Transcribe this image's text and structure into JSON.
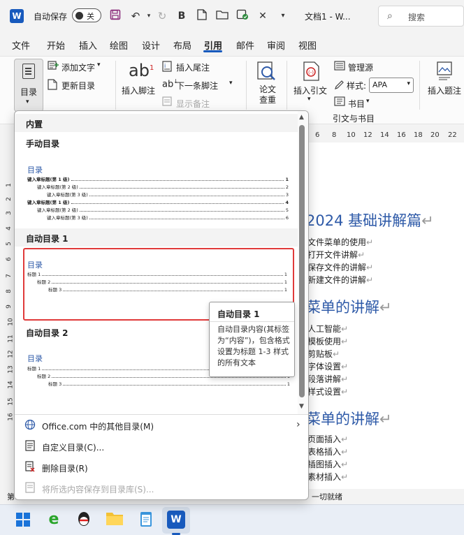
{
  "titlebar": {
    "autosave_label": "自动保存",
    "autosave_state": "关",
    "doc_title": "文档1 - W...",
    "search_placeholder": "搜索"
  },
  "tabs": [
    "文件",
    "开始",
    "插入",
    "绘图",
    "设计",
    "布局",
    "引用",
    "邮件",
    "审阅",
    "视图"
  ],
  "active_tab": "引用",
  "ribbon": {
    "toc_button": "目录",
    "add_text": "添加文字",
    "update_toc": "更新目录",
    "insert_footnote": "插入脚注",
    "insert_endnote": "插入尾注",
    "next_footnote": "下一条脚注",
    "show_notes": "显示备注",
    "research": "论文查重",
    "insert_citation": "插入引文",
    "manage_sources": "管理源",
    "style_label": "样式:",
    "style_value": "APA",
    "bibliography": "书目",
    "group_label": "引文与书目",
    "insert_caption": "插入题注"
  },
  "ruler": [
    "6",
    "8",
    "10",
    "12",
    "14",
    "16",
    "18",
    "20",
    "22"
  ],
  "ruler_left": [
    "1",
    "2",
    "3",
    "4",
    "5",
    "6",
    "7",
    "8",
    "9",
    "10",
    "11",
    "12",
    "13",
    "14",
    "15",
    "16"
  ],
  "toc_panel": {
    "builtin_header": "内置",
    "manual_title": "手动目录",
    "manual_preview": {
      "heading": "目录",
      "lines": [
        {
          "text": "键入章标题(第 1 级)",
          "page": "1",
          "level": 1
        },
        {
          "text": "键入章标题(第 2 级)",
          "page": "2",
          "level": 2
        },
        {
          "text": "键入章标题(第 3 级)",
          "page": "3",
          "level": 3
        },
        {
          "text": "键入章标题(第 1 级)",
          "page": "4",
          "level": 1
        },
        {
          "text": "键入章标题(第 2 级)",
          "page": "5",
          "level": 2
        },
        {
          "text": "键入章标题(第 3 级)",
          "page": "6",
          "level": 3
        }
      ]
    },
    "auto1_title": "自动目录 1",
    "auto1_preview": {
      "heading": "目录",
      "lines": [
        {
          "text": "标题 1",
          "page": "1",
          "level": 1
        },
        {
          "text": "标题 2",
          "page": "1",
          "level": 2
        },
        {
          "text": "标题 3",
          "page": "1",
          "level": 3
        }
      ]
    },
    "auto2_title": "自动目录 2",
    "auto2_preview": {
      "heading": "目录",
      "lines": [
        {
          "text": "标题 1",
          "page": "1",
          "level": 1
        },
        {
          "text": "标题 2",
          "page": "1",
          "level": 2
        },
        {
          "text": "标题 3",
          "page": "1",
          "level": 3
        }
      ]
    },
    "menu": {
      "more_toc": "Office.com 中的其他目录(M)",
      "custom_toc": "自定义目录(C)...",
      "remove_toc": "删除目录(R)",
      "save_selection": "将所选内容保存到目录库(S)..."
    }
  },
  "tooltip": {
    "title": "自动目录 1",
    "body": "自动目录内容(其标签为“内容”)，包含格式设置为标题 1-3 样式的所有文本"
  },
  "document": {
    "lines": [
      {
        "text": "2024 基础讲解篇",
        "type": "heading"
      },
      {
        "text": "文件菜单的使用",
        "type": "body"
      },
      {
        "text": "打开文件讲解",
        "type": "body"
      },
      {
        "text": "保存文件的讲解",
        "type": "body"
      },
      {
        "text": "新建文件的讲解",
        "type": "body"
      },
      {
        "text": "菜单的讲解",
        "type": "heading"
      },
      {
        "text": "人工智能",
        "type": "body"
      },
      {
        "text": "模板使用",
        "type": "body"
      },
      {
        "text": "剪贴板",
        "type": "body"
      },
      {
        "text": "字体设置",
        "type": "body"
      },
      {
        "text": "段落讲解",
        "type": "body"
      },
      {
        "text": "样式设置",
        "type": "body"
      },
      {
        "text": "菜单的讲解",
        "type": "heading"
      },
      {
        "text": "页面插入",
        "type": "body"
      },
      {
        "text": "表格插入",
        "type": "body"
      },
      {
        "text": "插图插入",
        "type": "body"
      },
      {
        "text": "素材插入",
        "type": "body"
      }
    ]
  },
  "statusbar": {
    "left": "第",
    "right": "一切就绪"
  },
  "colors": {
    "accent": "#185abd",
    "heading": "#2e5aa8",
    "selection_border": "#e03a3a"
  },
  "taskbar": [
    "windows-start",
    "ie-browser",
    "qq",
    "file-explorer",
    "notepad",
    "word"
  ]
}
